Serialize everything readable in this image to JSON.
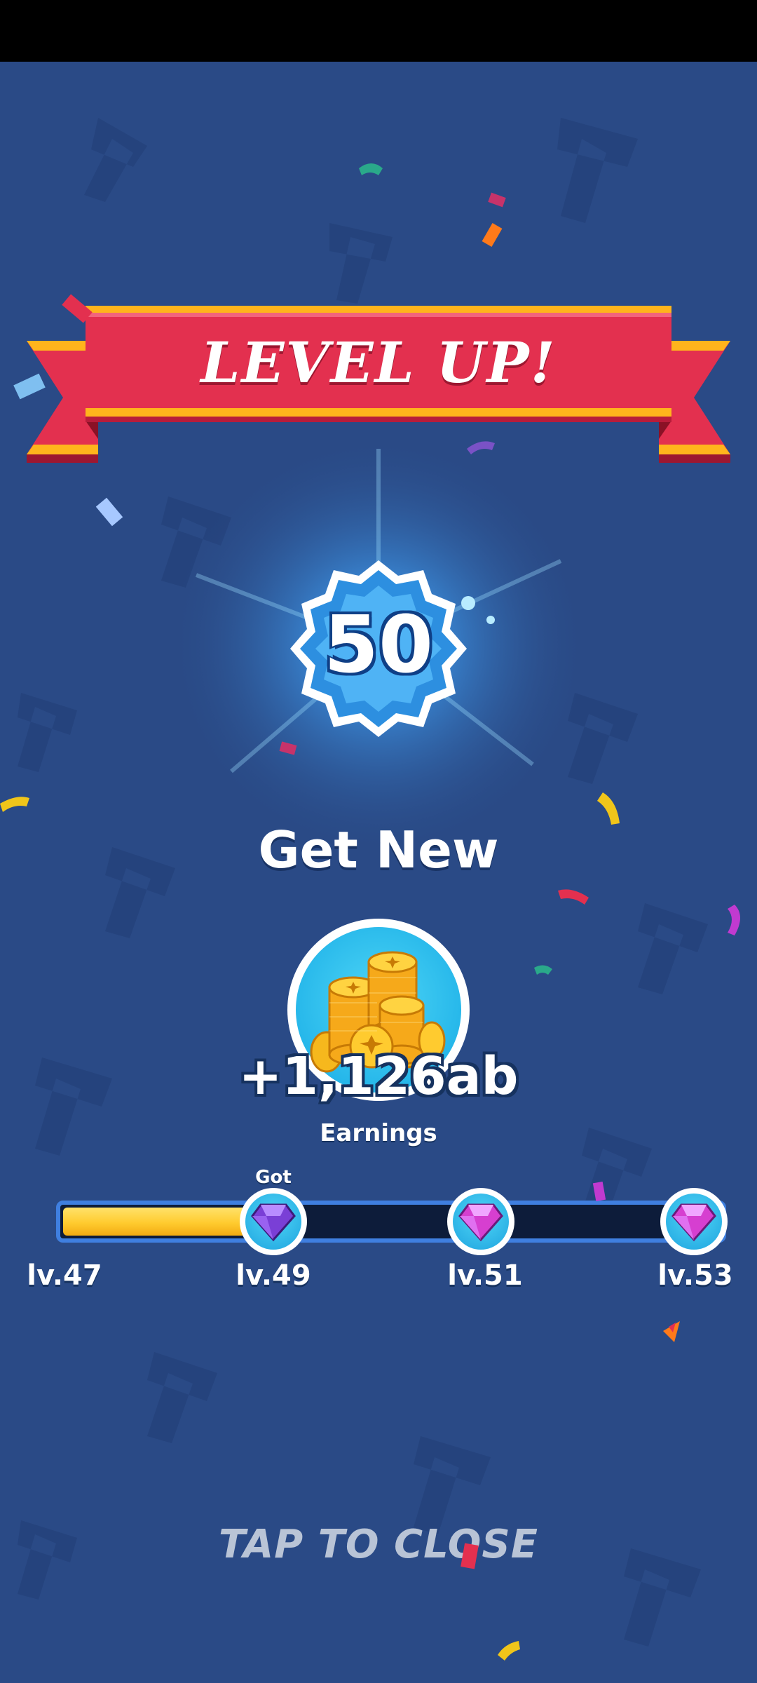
{
  "banner": {
    "title": "LEVEL UP!"
  },
  "level_badge": {
    "number": "50"
  },
  "reward": {
    "heading": "Get New",
    "amount": "+1,126ab",
    "label": "Earnings",
    "icon": "gold-coins-stack-icon"
  },
  "progress": {
    "fill_fraction": 0.33,
    "milestones": [
      {
        "level": "lv.47",
        "icon": "",
        "status": ""
      },
      {
        "level": "lv.49",
        "icon": "purple-gem-icon",
        "status": "Got"
      },
      {
        "level": "lv.51",
        "icon": "purple-gem-icon",
        "status": ""
      },
      {
        "level": "lv.53",
        "icon": "purple-gem-icon",
        "status": ""
      }
    ]
  },
  "footer": {
    "close_label": "TAP TO CLOSE"
  },
  "colors": {
    "background": "#2a4a86",
    "ribbon_red": "#e3304f",
    "ribbon_stripe": "#ffb41c",
    "progress_fill": "#ffcb2f",
    "badge_blue": "#2d8fe0"
  }
}
